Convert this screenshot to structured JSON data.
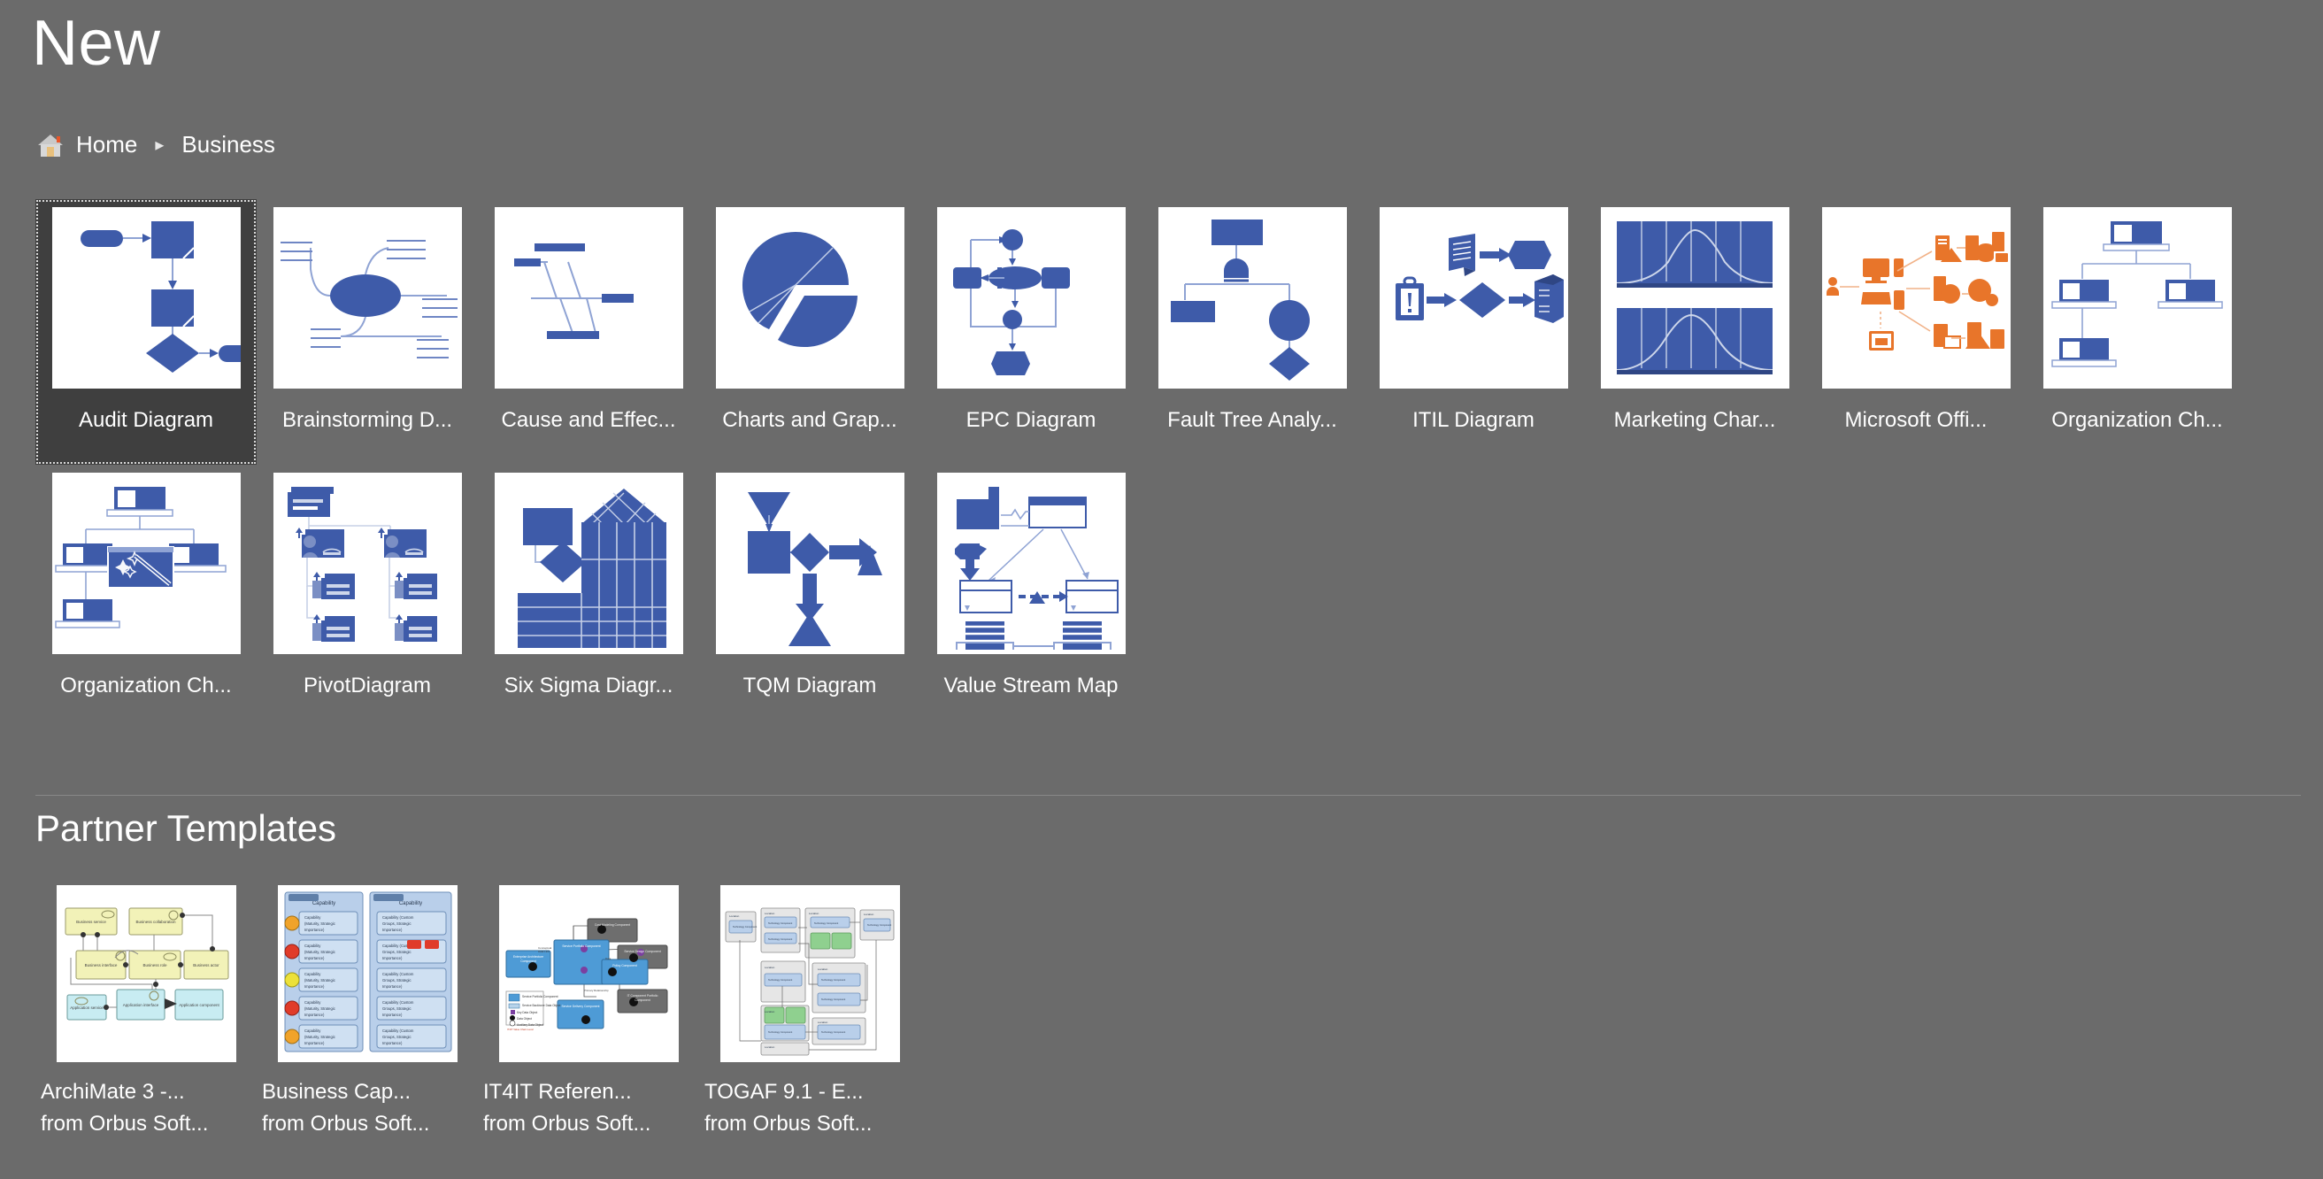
{
  "header": {
    "title": "New",
    "breadcrumb": {
      "home_icon": "home-icon",
      "home": "Home",
      "separator": "▸",
      "current": "Business"
    }
  },
  "colors": {
    "background": "#6b6b6b",
    "selected_tile": "#3f3f3f",
    "thumb_bg": "#ffffff",
    "accent_blue": "#3e5ba9",
    "accent_blue_light": "#8fa3d4",
    "accent_orange": "#e8752a",
    "text": "#ffffff",
    "divider": "#888888"
  },
  "templates": {
    "row1": [
      {
        "label": "Audit Diagram",
        "icon": "audit-diagram-thumb",
        "selected": true
      },
      {
        "label": "Brainstorming D...",
        "icon": "brainstorming-diagram-thumb",
        "selected": false
      },
      {
        "label": "Cause and Effec...",
        "icon": "cause-and-effect-thumb",
        "selected": false
      },
      {
        "label": "Charts and Grap...",
        "icon": "charts-and-graphs-thumb",
        "selected": false
      },
      {
        "label": "EPC Diagram",
        "icon": "epc-diagram-thumb",
        "selected": false
      },
      {
        "label": "Fault Tree Analy...",
        "icon": "fault-tree-analysis-thumb",
        "selected": false
      },
      {
        "label": "ITIL Diagram",
        "icon": "itil-diagram-thumb",
        "selected": false
      },
      {
        "label": "Marketing Char...",
        "icon": "marketing-charts-thumb",
        "selected": false
      },
      {
        "label": "Microsoft Offi...",
        "icon": "microsoft-office-thumb",
        "selected": false
      },
      {
        "label": "Organization Ch...",
        "icon": "organization-chart-thumb",
        "selected": false
      }
    ],
    "row2": [
      {
        "label": "Organization Ch...",
        "icon": "organization-chart-wizard-thumb",
        "selected": false
      },
      {
        "label": "PivotDiagram",
        "icon": "pivot-diagram-thumb",
        "selected": false
      },
      {
        "label": "Six Sigma Diagr...",
        "icon": "six-sigma-diagram-thumb",
        "selected": false
      },
      {
        "label": "TQM Diagram",
        "icon": "tqm-diagram-thumb",
        "selected": false
      },
      {
        "label": "Value Stream Map",
        "icon": "value-stream-map-thumb",
        "selected": false
      }
    ]
  },
  "partner_section": {
    "title": "Partner Templates",
    "items": [
      {
        "label": "ArchiMate 3 -...",
        "publisher": "from Orbus Soft...",
        "icon": "archimate-thumb"
      },
      {
        "label": "Business Cap...",
        "publisher": "from Orbus Soft...",
        "icon": "business-capability-thumb"
      },
      {
        "label": "IT4IT Referen...",
        "publisher": "from Orbus Soft...",
        "icon": "it4it-reference-thumb"
      },
      {
        "label": "TOGAF 9.1 - E...",
        "publisher": "from Orbus Soft...",
        "icon": "togaf-thumb"
      }
    ]
  }
}
